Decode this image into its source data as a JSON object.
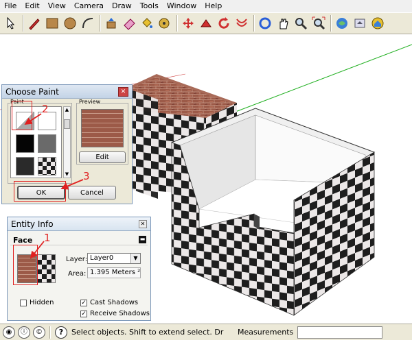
{
  "menu": [
    "File",
    "Edit",
    "View",
    "Camera",
    "Draw",
    "Tools",
    "Window",
    "Help"
  ],
  "toolbar": {
    "icons": [
      "select-icon",
      "pencil-icon",
      "rectangle-icon",
      "circle-icon",
      "arc-icon",
      "push-pull-icon",
      "eraser-icon",
      "paint-bucket-icon",
      "tape-measure-icon",
      "move-icon",
      "follow-me-icon",
      "rotate-icon",
      "offset-icon",
      "orbit-icon",
      "pan-icon",
      "zoom-icon",
      "zoom-extents-icon",
      "get-models-icon",
      "share-model-icon",
      "warehouse-icon"
    ]
  },
  "choose_paint": {
    "title": "Choose Paint",
    "paint_label": "Paint",
    "preview_label": "Preview",
    "edit_label": "Edit",
    "ok_label": "OK",
    "cancel_label": "Cancel"
  },
  "entity_info": {
    "title": "Entity Info",
    "type": "Face",
    "layer_label": "Layer:",
    "layer_value": "Layer0",
    "area_label": "Area:",
    "area_value": "1.395 Meters ²",
    "hidden_label": "Hidden",
    "hidden_checked": false,
    "cast_shadows_label": "Cast Shadows",
    "cast_shadows_checked": true,
    "receive_shadows_label": "Receive Shadows",
    "receive_shadows_checked": true
  },
  "annotations": [
    "1",
    "2",
    "3"
  ],
  "status": {
    "text": "Select objects. Shift to extend select. Dr",
    "measurements_label": "Measurements",
    "help_icon": "?"
  },
  "colors": {
    "brick": "#9c5a48",
    "check_dark": "#1e1e1e",
    "check_light": "#e8e4e4",
    "marker": "#e02020"
  }
}
